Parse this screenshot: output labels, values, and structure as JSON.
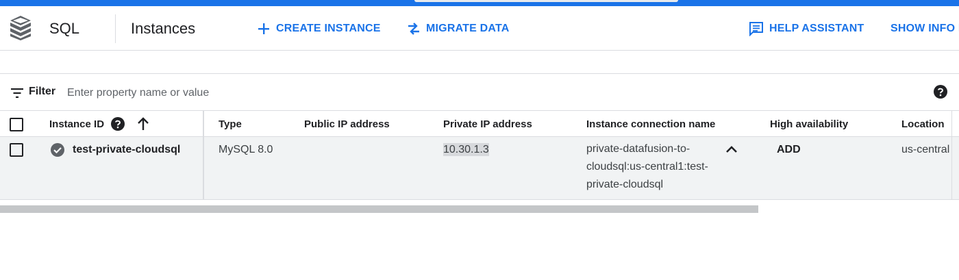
{
  "header": {
    "product_name": "SQL",
    "page_title": "Instances",
    "buttons": {
      "create_instance": "CREATE INSTANCE",
      "migrate_data": "MIGRATE DATA",
      "help_assistant": "HELP ASSISTANT",
      "show_info": "SHOW INFO P"
    },
    "accent_color": "#1a73e8"
  },
  "filter": {
    "label": "Filter",
    "placeholder": "Enter property name or value"
  },
  "table": {
    "columns": [
      "Instance ID",
      "Type",
      "Public IP address",
      "Private IP address",
      "Instance connection name",
      "High availability",
      "Location"
    ],
    "sort": {
      "column": "Instance ID",
      "direction": "ascending"
    },
    "rows": [
      {
        "status": "running",
        "instance_id": "test-private-cloudsql",
        "type": "MySQL 8.0",
        "public_ip": "",
        "private_ip": "10.30.1.3",
        "connection_name_lines": [
          "private-datafusion-to-",
          "cloudsql:us-central1:test-",
          "private-cloudsql"
        ],
        "high_availability": "ADD",
        "location": "us-central"
      }
    ]
  },
  "icons": [
    "sql-logo-icon",
    "plus-icon",
    "migrate-icon",
    "help-assistant-icon",
    "filter-icon",
    "help-circle-icon",
    "sort-up-arrow-icon",
    "status-check-icon",
    "chevron-up-icon"
  ]
}
